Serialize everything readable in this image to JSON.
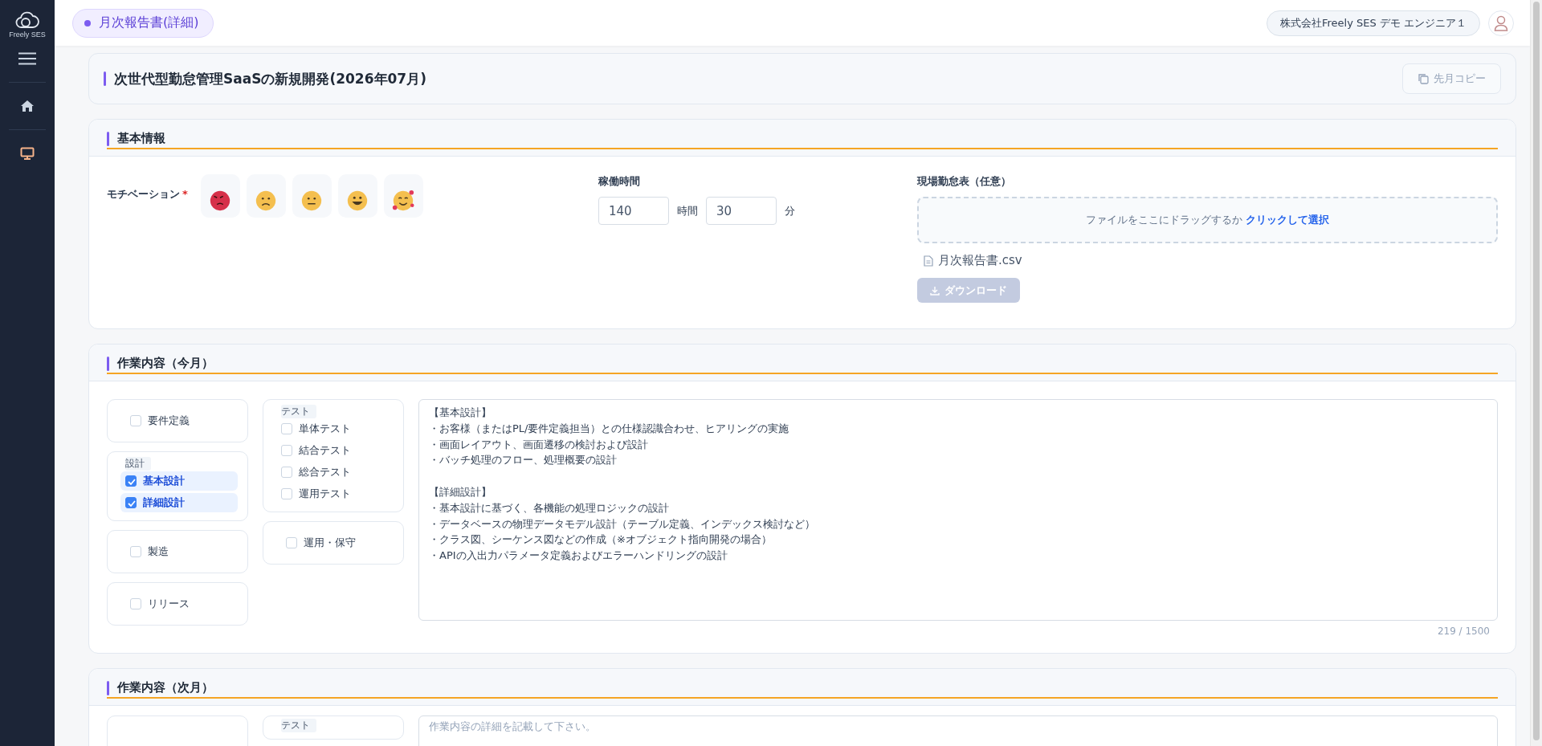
{
  "sidebar": {
    "logo_text": "Freely SES",
    "nav": [
      {
        "kind": "home",
        "selected": false
      },
      {
        "kind": "monitor",
        "selected": true
      }
    ]
  },
  "header": {
    "page_tab": "月次報告書(詳細)",
    "user": "株式会社Freely SES デモ エンジニア１"
  },
  "title_card": {
    "title": "次世代型勤怠管理SaaSの新規開発(2026年07月)",
    "copy_button": "先月コピー"
  },
  "basic_info": {
    "heading": "基本情報",
    "motivation_label": "モチベーション",
    "required_mark": "*",
    "moods": [
      {
        "kind": "angry"
      },
      {
        "kind": "sad"
      },
      {
        "kind": "neutral"
      },
      {
        "kind": "happy"
      },
      {
        "kind": "love"
      }
    ],
    "hours_label": "稼働時間",
    "hours": "140",
    "hours_unit": "時間",
    "minutes": "30",
    "minutes_unit": "分",
    "attendance_label": "現場勤怠表（任意）",
    "dropzone_text": "ファイルをここにドラッグするか",
    "dropzone_link": "クリックして選択",
    "file_name": "月次報告書.csv",
    "download_button": {
      "label": "ダウンロード",
      "disabled": true
    }
  },
  "work_this_month": {
    "heading": "作業内容（今月）",
    "columns": [
      [
        {
          "kind": "single",
          "label": "要件定義",
          "checked": false
        },
        {
          "kind": "group",
          "legend": "設計",
          "items": [
            {
              "label": "基本設計",
              "checked": true
            },
            {
              "label": "詳細設計",
              "checked": true
            }
          ]
        },
        {
          "kind": "single",
          "label": "製造",
          "checked": false
        },
        {
          "kind": "single",
          "label": "リリース",
          "checked": false
        }
      ],
      [
        {
          "kind": "group",
          "legend": "テスト",
          "items": [
            {
              "label": "単体テスト",
              "checked": false
            },
            {
              "label": "結合テスト",
              "checked": false
            },
            {
              "label": "総合テスト",
              "checked": false
            },
            {
              "label": "運用テスト",
              "checked": false
            }
          ]
        },
        {
          "kind": "single",
          "label": "運用・保守",
          "checked": false
        }
      ]
    ],
    "details": [
      [
        "【基本設計】",
        "・お客様（またはPL/要件定義担当）との仕様認識合わせ、ヒアリングの実施",
        "・画面レイアウト、画面遷移の検討および設計",
        "・バッチ処理のフロー、処理概要の設計"
      ],
      [
        "【詳細設計】",
        "・基本設計に基づく、各機能の処理ロジックの設計",
        "・データベースの物理データモデル設計（テーブル定義、インデックス検討など）",
        "・クラス図、シーケンス図などの作成（※オブジェクト指向開発の場合）",
        "・APIの入出力パラメータ定義およびエラーハンドリングの設計"
      ]
    ],
    "count": "219 / 1500"
  },
  "work_next_month": {
    "heading": "作業内容（次月）",
    "columns": [
      [
        {
          "kind": "single"
        }
      ],
      [
        {
          "kind": "group",
          "legend": "テスト"
        }
      ]
    ],
    "placeholder": "作業内容の詳細を記載して下さい。"
  }
}
